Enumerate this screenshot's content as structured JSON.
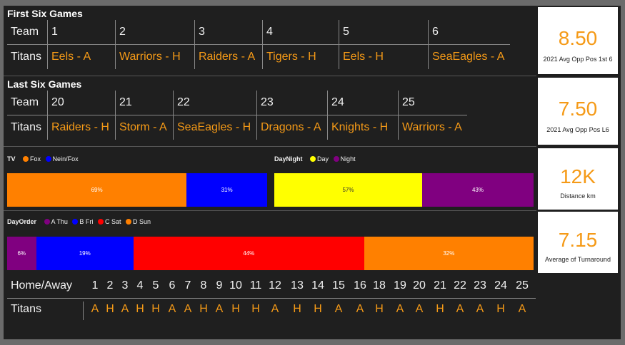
{
  "first_six": {
    "title": "First Six Games",
    "header_label": "Team",
    "games": [
      "1",
      "2",
      "3",
      "4",
      "5",
      "6"
    ],
    "row_label": "Titans",
    "opponents": [
      "Eels - A",
      "Warriors - H",
      "Raiders - A",
      "Tigers - H",
      "Eels - H",
      "SeaEagles - A"
    ]
  },
  "last_six": {
    "title": "Last Six Games",
    "header_label": "Team",
    "games": [
      "20",
      "21",
      "22",
      "23",
      "24",
      "25"
    ],
    "row_label": "Titans",
    "opponents": [
      "Raiders - H",
      "Storm - A",
      "SeaEagles - H",
      "Dragons - A",
      "Knights - H",
      "Warriors - A"
    ]
  },
  "kpis": [
    {
      "value": "8.50",
      "label": "2021 Avg Opp Pos 1st 6"
    },
    {
      "value": "7.50",
      "label": "2021 Avg Opp Pos L6"
    },
    {
      "value": "12K",
      "label": "Distance km"
    },
    {
      "value": "7.15",
      "label": "Average of Turnaround"
    }
  ],
  "tv": {
    "title": "TV",
    "legend": [
      {
        "name": "Fox",
        "color": "#ff8000"
      },
      {
        "name": "Nein/Fox",
        "color": "#0000ff"
      }
    ],
    "segments": [
      {
        "label": "69%",
        "value": 69,
        "color": "#ff8000"
      },
      {
        "label": "31%",
        "value": 31,
        "color": "#0000ff"
      }
    ]
  },
  "daynight": {
    "title": "DayNight",
    "legend": [
      {
        "name": "Day",
        "color": "#ffff00"
      },
      {
        "name": "Night",
        "color": "#800080"
      }
    ],
    "segments": [
      {
        "label": "57%",
        "value": 57,
        "color": "#ffff00"
      },
      {
        "label": "43%",
        "value": 43,
        "color": "#800080"
      }
    ]
  },
  "dayorder": {
    "title": "DayOrder",
    "legend": [
      {
        "name": "A Thu",
        "color": "#800080"
      },
      {
        "name": "B Fri",
        "color": "#0000ff"
      },
      {
        "name": "C Sat",
        "color": "#ff0000"
      },
      {
        "name": "D Sun",
        "color": "#ff8000"
      }
    ],
    "segments": [
      {
        "label": "6%",
        "value": 5.5,
        "color": "#800080"
      },
      {
        "label": "19%",
        "value": 18.5,
        "color": "#0000ff"
      },
      {
        "label": "44%",
        "value": 43.8,
        "color": "#ff0000"
      },
      {
        "label": "32%",
        "value": 32.2,
        "color": "#ff8000"
      }
    ]
  },
  "home_away": {
    "header_label": "Home/Away",
    "rounds": [
      "1",
      "2",
      "3",
      "4",
      "5",
      "6",
      "7",
      "8",
      "9",
      "10",
      "11",
      "12",
      "13",
      "14",
      "15",
      "16",
      "18",
      "19",
      "20",
      "21",
      "22",
      "23",
      "24",
      "25"
    ],
    "row_label": "Titans",
    "values": [
      "A",
      "H",
      "A",
      "H",
      "H",
      "A",
      "A",
      "H",
      "A",
      "H",
      "H",
      "A",
      "H",
      "H",
      "A",
      "A",
      "H",
      "A",
      "A",
      "H",
      "A",
      "A",
      "H",
      "A"
    ]
  }
}
